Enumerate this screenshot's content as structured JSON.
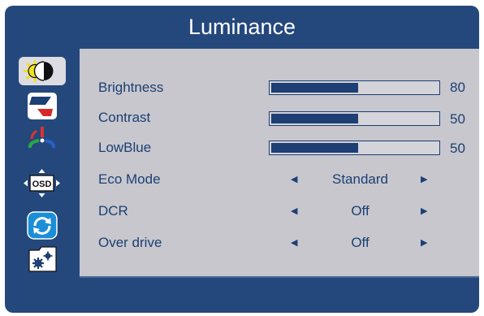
{
  "title": "Luminance",
  "sidebar": {
    "items": [
      {
        "icon": "brightness-icon",
        "active": true
      },
      {
        "icon": "image-icon"
      },
      {
        "icon": "color-icon"
      },
      {
        "icon": "osd-icon",
        "text": "OSD"
      },
      {
        "icon": "reset-icon"
      },
      {
        "icon": "extra-settings-icon"
      }
    ]
  },
  "menu": {
    "sliders": [
      {
        "label": "Brightness",
        "value": "80",
        "level": 0.52
      },
      {
        "label": "Contrast",
        "value": "50",
        "level": 0.52
      },
      {
        "label": "LowBlue",
        "value": "50",
        "level": 0.52
      }
    ],
    "options": [
      {
        "label": "Eco Mode",
        "value": "Standard"
      },
      {
        "label": "DCR",
        "value": "Off"
      },
      {
        "label": "Over drive",
        "value": "Off"
      }
    ],
    "arrow_left": "◀",
    "arrow_right": "▶"
  },
  "colors": {
    "frame": "#24487c",
    "panel": "#c7c7cd",
    "text": "#1d3f74"
  }
}
